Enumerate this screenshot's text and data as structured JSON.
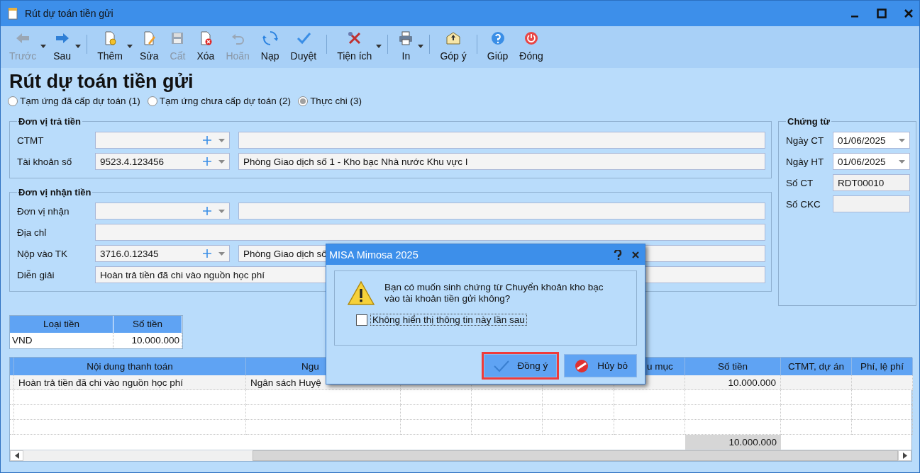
{
  "window": {
    "title": "Rút dự toán tiền gửi"
  },
  "toolbar": {
    "groups": [
      [
        {
          "label": "Trước",
          "disabled": true,
          "dropdown": true
        },
        {
          "label": "Sau",
          "disabled": false,
          "dropdown": true
        }
      ],
      [
        {
          "label": "Thêm",
          "disabled": false,
          "dropdown": true
        },
        {
          "label": "Sửa",
          "disabled": false,
          "dropdown": false
        },
        {
          "label": "Cất",
          "disabled": true,
          "dropdown": false
        },
        {
          "label": "Xóa",
          "disabled": false,
          "dropdown": false
        },
        {
          "label": "Hoãn",
          "disabled": true,
          "dropdown": false
        },
        {
          "label": "Nạp",
          "disabled": false,
          "dropdown": false
        },
        {
          "label": "Duyệt",
          "disabled": false,
          "dropdown": false
        }
      ],
      [
        {
          "label": "Tiện ích",
          "disabled": false,
          "dropdown": true
        }
      ],
      [
        {
          "label": "In",
          "disabled": false,
          "dropdown": true
        }
      ],
      [
        {
          "label": "Góp ý",
          "disabled": false,
          "dropdown": false
        }
      ],
      [
        {
          "label": "Giúp",
          "disabled": false,
          "dropdown": false
        },
        {
          "label": "Đóng",
          "disabled": false,
          "dropdown": false
        }
      ]
    ]
  },
  "heading": "Rút dự toán tiền gửi",
  "options": [
    {
      "label": "Tạm ứng đã cấp dự toán (1)",
      "selected": false
    },
    {
      "label": "Tạm ứng chưa cấp dự toán (2)",
      "selected": false
    },
    {
      "label": "Thực chi (3)",
      "selected": true
    }
  ],
  "sections": [
    {
      "title": "Đơn vị trả tiền",
      "rows": [
        {
          "kind": "combo",
          "label": "CTMT"
        },
        {
          "kind": "combo",
          "label": "Tài khoản số",
          "value": "9523.4.123456",
          "name": "Phòng Giao dịch số 1 - Kho bạc Nhà nước Khu vực I"
        }
      ]
    },
    {
      "title": "Đơn vị nhận tiền",
      "rows": [
        {
          "kind": "combo",
          "label": "Đơn vị nhận"
        },
        {
          "kind": "text",
          "label": "Địa chỉ"
        },
        {
          "kind": "combo",
          "label": "Nộp vào TK",
          "value": "3716.0.12345",
          "name": "Phòng Giao dịch số"
        },
        {
          "kind": "text",
          "label": "Diễn giải",
          "value": "Hoàn trả tiền đã chi vào nguồn học phí"
        }
      ]
    }
  ],
  "voucher": {
    "title": "Chứng từ",
    "rows": [
      {
        "kind": "date",
        "label": "Ngày CT",
        "value": "01/06/2025"
      },
      {
        "kind": "date",
        "label": "Ngày HT",
        "value": "01/06/2025"
      },
      {
        "kind": "readonly",
        "label": "Số CT",
        "value": "RDT00010"
      },
      {
        "kind": "readonly",
        "label": "Số CKC"
      }
    ]
  },
  "currency_table": {
    "columns": [
      "Loại tiền",
      "Số tiền"
    ],
    "rows": [
      [
        "VND",
        "10.000.000"
      ]
    ]
  },
  "table": {
    "columns": [
      {
        "label": "Nội dung thanh toán"
      },
      {
        "label": "Ngu"
      },
      {},
      {},
      {},
      {
        "label": "u mục"
      },
      {
        "label": "Số tiền"
      },
      {
        "label": "CTMT, dự án"
      },
      {
        "label": "Phí, lệ phí"
      }
    ],
    "rows": [
      {
        "cells": {
          "0": "Hoàn trả tiền đã chi vào nguồn học phí",
          "1": "Ngân sách Huyệ",
          "6": "10.000.000"
        }
      }
    ],
    "total": {
      "6": "10.000.000"
    }
  },
  "dialog": {
    "title": "MISA Mimosa 2025",
    "message": "Bạn có muốn sinh chứng từ Chuyển khoản kho bạc vào tài khoản tiền gửi không?",
    "checkbox": {
      "label": "Không hiển thị thông tin này lần sau",
      "checked": false
    },
    "buttons": [
      {
        "label": "Đồng ý",
        "kind": "ok",
        "highlighted": true
      },
      {
        "label": "Hủy bỏ",
        "kind": "cancel",
        "highlighted": false
      }
    ]
  }
}
